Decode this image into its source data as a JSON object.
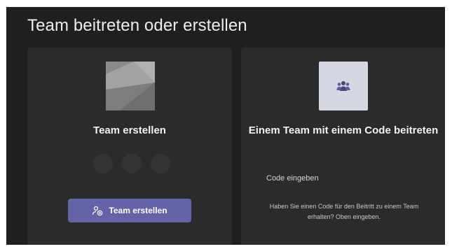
{
  "dialog": {
    "title": "Team beitreten oder erstellen"
  },
  "create_card": {
    "illustration": "team-create-illustration",
    "title": "Team erstellen",
    "button_icon": "team-create-icon",
    "button_label": "Team erstellen"
  },
  "join_card": {
    "icon": "teams-people-icon",
    "title": "Einem Team mit einem Code beitreten",
    "code_label": "Code eingeben",
    "help_text": "Haben Sie einen Code für den Beitritt zu einem Team erhalten? Oben eingeben."
  },
  "colors": {
    "background": "#1f1f1f",
    "card": "#2b2b2b",
    "accent": "#6264a7"
  }
}
